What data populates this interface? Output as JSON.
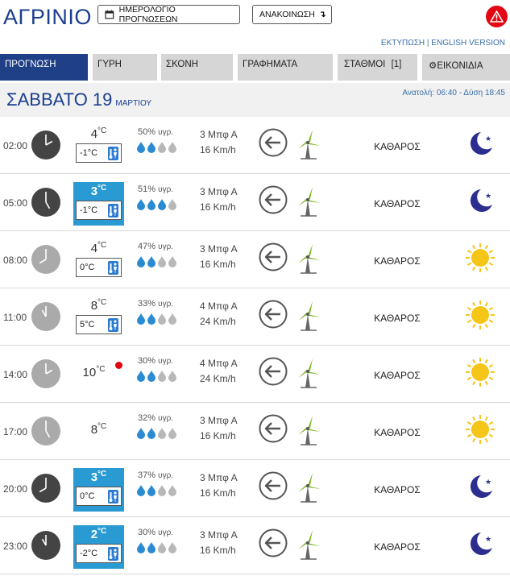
{
  "header": {
    "city": "ΑΓΡΙΝΙΟ",
    "calendar_button": "ΗΜΕΡΟΛΟΓΙΟ ΠΡΟΓΝΩΣΕΩΝ",
    "announcement_button": "ΑΝΑΚΟΙΝΩΣΗ",
    "print_link": "ΕΚΤΥΠΩΣΗ",
    "separator": "|",
    "english_link": "ENGLISH VERSION"
  },
  "tabs": [
    {
      "label": "ΠΡΟΓΝΩΣΗ",
      "active": true
    },
    {
      "label": "ΓΥΡΗ",
      "active": false
    },
    {
      "label": "ΣΚΟΝΗ",
      "active": false
    },
    {
      "label": "ΓΡΑΦΗΜΑΤΑ",
      "active": false
    },
    {
      "label": "ΣΤΑΘΜΟΙ",
      "badge": "[1]",
      "active": false
    },
    {
      "label": "ΕΙΚΟΝΙΔΙΑ",
      "active": false
    }
  ],
  "day": {
    "day_name": "ΣΑΒΒΑΤΟ 19",
    "month": "ΜΑΡΤΙΟΥ",
    "sunrise_label": "Ανατολή:",
    "sunrise": "06:40",
    "sunset_label": "- Δύση",
    "sunset": "18:45"
  },
  "colors": {
    "accent": "#1f3f87",
    "highlight": "#2a9ad2",
    "alert": "#e20613",
    "sun": "#f5c518",
    "moon": "#2b2d8f",
    "windmill": "#7ab51d"
  },
  "rows": [
    {
      "time": "02:00",
      "hour": 2,
      "night": true,
      "temp": "4",
      "unit": "°C",
      "feels": "-1°C",
      "highlight": false,
      "humidity": "50%",
      "hum_label": "υγρ.",
      "drops": 2,
      "beaufort": "3 Μπφ Α",
      "kmh": "16 Km/h",
      "condition": "ΚΑΘΑΡΟΣ",
      "icon": "moon-icon"
    },
    {
      "time": "05:00",
      "hour": 5,
      "night": true,
      "temp": "3",
      "unit": "°C",
      "feels": "-1°C",
      "highlight": true,
      "humidity": "51%",
      "hum_label": "υγρ.",
      "drops": 3,
      "beaufort": "3 Μπφ Α",
      "kmh": "16 Km/h",
      "condition": "ΚΑΘΑΡΟΣ",
      "icon": "moon-icon"
    },
    {
      "time": "08:00",
      "hour": 8,
      "night": false,
      "temp": "4",
      "unit": "°C",
      "feels": "0°C",
      "highlight": false,
      "humidity": "47%",
      "hum_label": "υγρ.",
      "drops": 2,
      "beaufort": "3 Μπφ Α",
      "kmh": "16 Km/h",
      "condition": "ΚΑΘΑΡΟΣ",
      "icon": "sun-icon"
    },
    {
      "time": "11:00",
      "hour": 11,
      "night": false,
      "temp": "8",
      "unit": "°C",
      "feels": "5°C",
      "highlight": false,
      "humidity": "33%",
      "hum_label": "υγρ.",
      "drops": 2,
      "beaufort": "4 Μπφ Α",
      "kmh": "24 Km/h",
      "condition": "ΚΑΘΑΡΟΣ",
      "icon": "sun-icon"
    },
    {
      "time": "14:00",
      "hour": 14,
      "night": false,
      "temp": "10",
      "unit": "°C",
      "feels": "",
      "highlight": false,
      "max": true,
      "humidity": "30%",
      "hum_label": "υγρ.",
      "drops": 2,
      "beaufort": "4 Μπφ Α",
      "kmh": "24 Km/h",
      "condition": "ΚΑΘΑΡΟΣ",
      "icon": "sun-icon"
    },
    {
      "time": "17:00",
      "hour": 17,
      "night": false,
      "temp": "8",
      "unit": "°C",
      "feels": "",
      "highlight": false,
      "humidity": "32%",
      "hum_label": "υγρ.",
      "drops": 2,
      "beaufort": "3 Μπφ Α",
      "kmh": "16 Km/h",
      "condition": "ΚΑΘΑΡΟΣ",
      "icon": "sun-icon"
    },
    {
      "time": "20:00",
      "hour": 20,
      "night": true,
      "temp": "3",
      "unit": "°C",
      "feels": "0°C",
      "highlight": true,
      "humidity": "37%",
      "hum_label": "υγρ.",
      "drops": 2,
      "beaufort": "3 Μπφ Α",
      "kmh": "16 Km/h",
      "condition": "ΚΑΘΑΡΟΣ",
      "icon": "moon-icon"
    },
    {
      "time": "23:00",
      "hour": 23,
      "night": true,
      "temp": "2",
      "unit": "°C",
      "feels": "-2°C",
      "highlight": true,
      "humidity": "30%",
      "hum_label": "υγρ.",
      "drops": 2,
      "beaufort": "3 Μπφ Α",
      "kmh": "16 Km/h",
      "condition": "ΚΑΘΑΡΟΣ",
      "icon": "moon-icon"
    }
  ]
}
